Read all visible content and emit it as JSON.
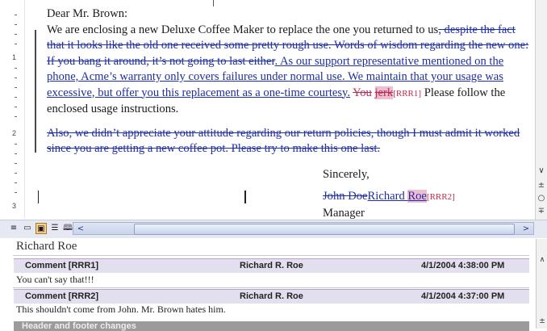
{
  "ruler": {
    "numbers": [
      "1",
      "2",
      "3"
    ]
  },
  "document": {
    "salutation": "Dear Mr. Brown:",
    "p1_ins1": "We are enclosing a new Deluxe Coffee Maker to replace the one you returned to us",
    "p1_del1": ", despite the fact that it looks like the old one received some pretty rough use.  Words of wisdom regarding the new one: If you bang it around, it’s not going to last either",
    "p1_ins2": ". As our support representative mentioned on the phone, Acme’s warranty only covers failures under normal use. We maintain that your usage was excessive, but offer you this replacement as a one-time courtesy.",
    "p1_del2": "You",
    "p1_del3": "jerk",
    "p1_mark1": "[RRR1]",
    "p1_rest": "Please follow the enclosed usage instructions.",
    "p2_del": "Also, we didn’t appreciate your attitude regarding our return policies, though I must admit it worked since you are getting a new coffee pot.  Please try to make this one last.",
    "closing": "Sincerely,",
    "sig_del": "John Doe",
    "sig_ins1": "Richard ",
    "sig_ins2": "Roe",
    "sig_mark": "[RRR2]",
    "title": "Manager"
  },
  "view_buttons": {
    "normal": "≡",
    "web": "▭",
    "print": "▣",
    "outline": "☰",
    "reading": "🕮"
  },
  "scroll": {
    "left_arrow": "<",
    "right_arrow": ">",
    "down_arrow": "∨",
    "prev": "±",
    "select": "○",
    "next": "∓"
  },
  "reviewing_pane": {
    "title": "Richard Roe",
    "comments": [
      {
        "label": "Comment [RRR1]",
        "author": "Richard R. Roe",
        "timestamp": "4/1/2004 4:38:00 PM",
        "text": "You can't say that!!!"
      },
      {
        "label": "Comment [RRR2]",
        "author": "Richard R. Roe",
        "timestamp": "4/1/2004 4:37:00 PM",
        "text": "This shouldn't come from John. Mr. Brown hates him."
      }
    ],
    "section_header": "Header and footer changes"
  }
}
